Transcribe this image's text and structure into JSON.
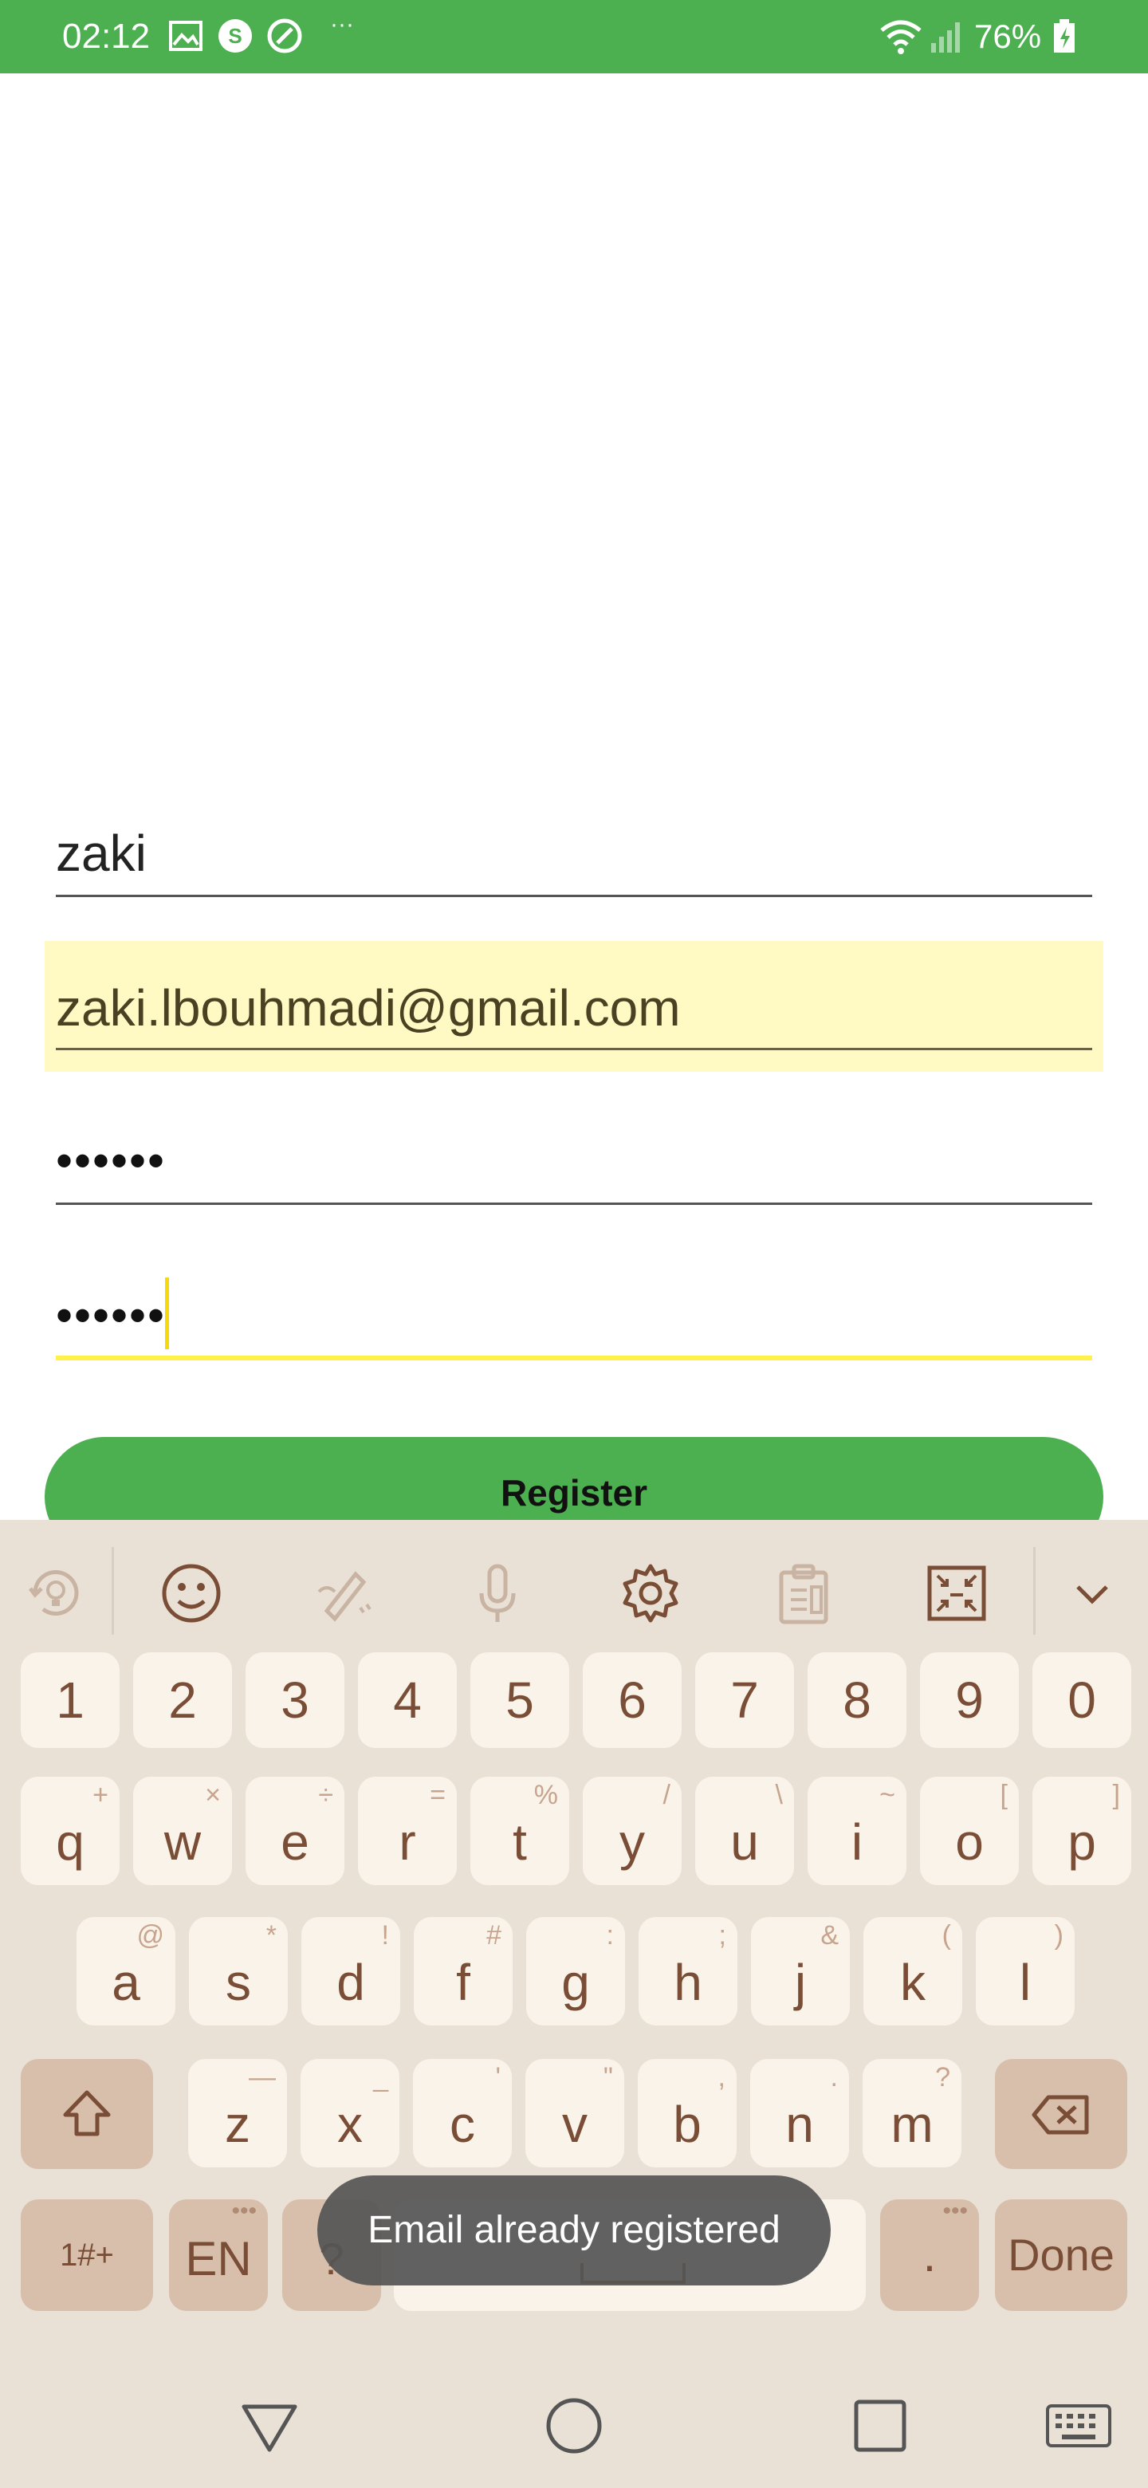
{
  "status_bar": {
    "time": "02:12",
    "more": "···",
    "battery_percent": "76%",
    "icons": [
      "image-icon",
      "skype-icon",
      "circle-app-icon",
      "wifi-icon",
      "signal-icon",
      "battery-icon"
    ]
  },
  "form": {
    "username_value": "zaki",
    "email_value": "zaki.lbouhmadi@gmail.com",
    "password_value": "••••••",
    "confirm_password_value": "••••••",
    "register_label": "Register"
  },
  "keyboard": {
    "toolbar_icons": [
      "rotate-icon",
      "emoji-icon",
      "handwriting-icon",
      "mic-icon",
      "settings-icon",
      "clipboard-icon",
      "resize-keyboard-icon",
      "collapse-keyboard-icon"
    ],
    "number_row": [
      "1",
      "2",
      "3",
      "4",
      "5",
      "6",
      "7",
      "8",
      "9",
      "0"
    ],
    "row1": [
      {
        "key": "q",
        "hint": "+"
      },
      {
        "key": "w",
        "hint": "×"
      },
      {
        "key": "e",
        "hint": "÷"
      },
      {
        "key": "r",
        "hint": "="
      },
      {
        "key": "t",
        "hint": "%"
      },
      {
        "key": "y",
        "hint": "/"
      },
      {
        "key": "u",
        "hint": "\\"
      },
      {
        "key": "i",
        "hint": "~"
      },
      {
        "key": "o",
        "hint": "["
      },
      {
        "key": "p",
        "hint": "]"
      }
    ],
    "row2": [
      {
        "key": "a",
        "hint": "@"
      },
      {
        "key": "s",
        "hint": "*"
      },
      {
        "key": "d",
        "hint": "!"
      },
      {
        "key": "f",
        "hint": "#"
      },
      {
        "key": "g",
        "hint": ":"
      },
      {
        "key": "h",
        "hint": ";"
      },
      {
        "key": "j",
        "hint": "&"
      },
      {
        "key": "k",
        "hint": "("
      },
      {
        "key": "l",
        "hint": ")"
      }
    ],
    "row3": [
      {
        "key": "z",
        "hint": "—"
      },
      {
        "key": "x",
        "hint": "_"
      },
      {
        "key": "c",
        "hint": "'"
      },
      {
        "key": "v",
        "hint": "\""
      },
      {
        "key": "b",
        "hint": ","
      },
      {
        "key": "n",
        "hint": "."
      },
      {
        "key": "m",
        "hint": "?"
      }
    ],
    "symbols_label": "1#+",
    "language_label": "EN",
    "question_label": "?",
    "period_label": ".",
    "done_label": "Done"
  },
  "toast": {
    "message": "Email already registered"
  },
  "nav_bar": {
    "icons": [
      "back-icon",
      "home-icon",
      "recents-icon",
      "keyboard-switch-icon"
    ]
  },
  "colors": {
    "accent_green": "#4caf50",
    "email_highlight": "#fff9c4",
    "focus_yellow": "#fff14a",
    "keyboard_bg": "#eae1d6",
    "key_bg": "#faf3ea",
    "key_text": "#7a4e36"
  }
}
